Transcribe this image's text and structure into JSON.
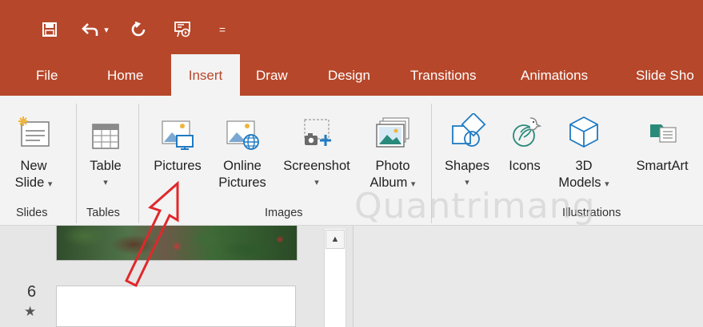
{
  "quick_access": {
    "icons": [
      "save-icon",
      "undo-icon",
      "redo-icon",
      "present-from-start-icon",
      "customize-qat-icon"
    ],
    "undo_caret": "▾",
    "customize_glyph": "="
  },
  "tabs": [
    {
      "label": "File",
      "active": false
    },
    {
      "label": "Home",
      "active": false
    },
    {
      "label": "Insert",
      "active": true
    },
    {
      "label": "Draw",
      "active": false
    },
    {
      "label": "Design",
      "active": false
    },
    {
      "label": "Transitions",
      "active": false
    },
    {
      "label": "Animations",
      "active": false
    },
    {
      "label": "Slide Sho",
      "active": false
    }
  ],
  "ribbon": {
    "buttons": {
      "new_slide": {
        "line1": "New",
        "line2": "Slide",
        "caret": "▾"
      },
      "table": {
        "line1": "Table",
        "caret": "▾"
      },
      "pictures": {
        "line1": "Pictures"
      },
      "online_pictures": {
        "line1": "Online",
        "line2": "Pictures"
      },
      "screenshot": {
        "line1": "Screenshot",
        "caret": "▾"
      },
      "photo_album": {
        "line1": "Photo",
        "line2": "Album",
        "caret": "▾"
      },
      "shapes": {
        "line1": "Shapes",
        "caret": "▾"
      },
      "icons": {
        "line1": "Icons"
      },
      "models_3d": {
        "line1": "3D",
        "line2": "Models",
        "caret": "▾"
      },
      "smartart": {
        "line1": "SmartArt"
      }
    },
    "groups": {
      "slides": "Slides",
      "tables": "Tables",
      "images": "Images",
      "illustrations": "Illustrations"
    }
  },
  "slide_pane": {
    "next_slide_number": "6",
    "transition_marker": "★",
    "scroll_up_glyph": "▲"
  },
  "watermark": "Quantrimang",
  "colors": {
    "accent": "#b7472a",
    "ribbon_bg": "#f3f3f3",
    "arrow": "#e0282c",
    "icon_blue": "#1f7ac2",
    "icon_teal": "#2a8a7a"
  }
}
